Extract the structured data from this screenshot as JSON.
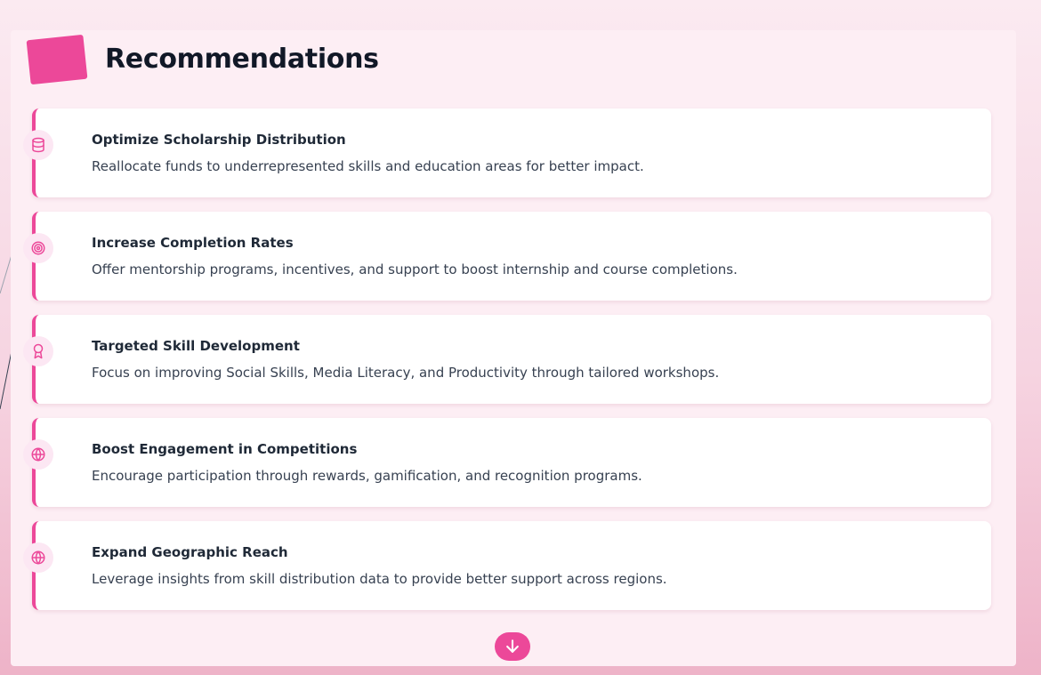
{
  "header": {
    "title": "Recommendations"
  },
  "colors": {
    "accent": "#ec4899",
    "icon_bg": "#fce7f3"
  },
  "recommendations": [
    {
      "icon": "database-icon",
      "title": "Optimize Scholarship Distribution",
      "description": "Reallocate funds to underrepresented skills and education areas for better impact."
    },
    {
      "icon": "target-icon",
      "title": "Increase Completion Rates",
      "description": "Offer mentorship programs, incentives, and support to boost internship and course completions."
    },
    {
      "icon": "award-icon",
      "title": "Targeted Skill Development",
      "description": "Focus on improving Social Skills, Media Literacy, and Productivity through tailored workshops."
    },
    {
      "icon": "globe-icon",
      "title": "Boost Engagement in Competitions",
      "description": "Encourage participation through rewards, gamification, and recognition programs."
    },
    {
      "icon": "globe-icon",
      "title": "Expand Geographic Reach",
      "description": "Leverage insights from skill distribution data to provide better support across regions."
    }
  ],
  "scroll_button": {
    "icon": "arrow-down-icon"
  }
}
